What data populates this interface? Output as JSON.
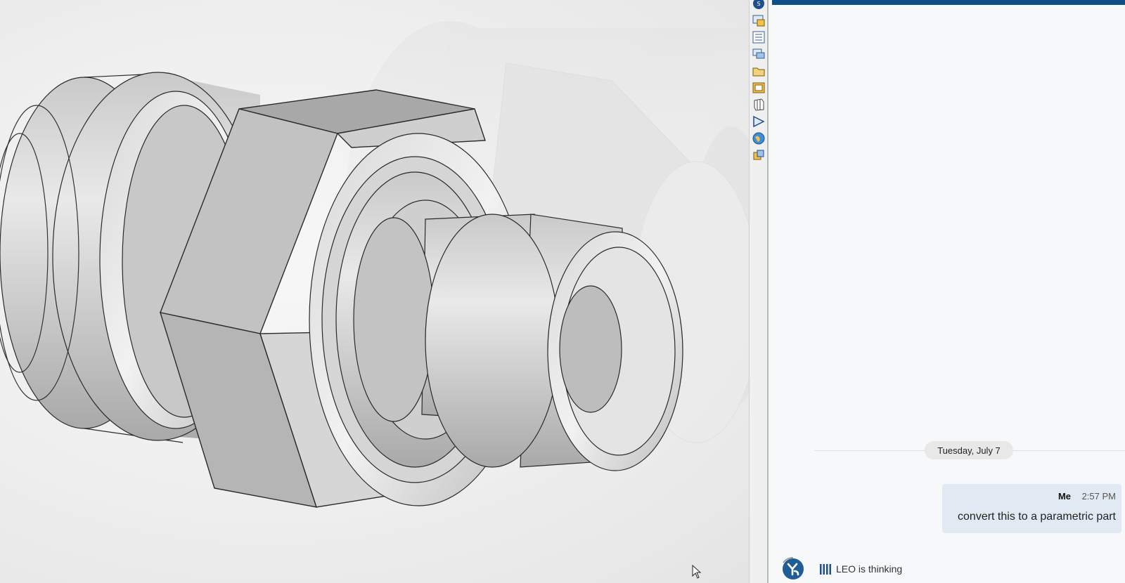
{
  "viewport": {
    "description_icon": "3d-cad-model"
  },
  "task_pane": {
    "buttons": [
      {
        "name": "solidworks-resources-icon"
      },
      {
        "name": "3d-content-central-icon"
      },
      {
        "name": "design-library-icon"
      },
      {
        "name": "forum-icon"
      },
      {
        "name": "file-explorer-icon"
      },
      {
        "name": "view-palette-icon"
      },
      {
        "name": "appearances-icon"
      },
      {
        "name": "custom-properties-icon"
      },
      {
        "name": "globe-icon"
      },
      {
        "name": "sustainability-icon"
      }
    ]
  },
  "chat": {
    "accent_color": "#0e4f86",
    "date_separator": "Tuesday, July 7",
    "messages": [
      {
        "sender": "Me",
        "time": "2:57 PM",
        "text": "convert this to a parametric part"
      }
    ],
    "assistant_status": "LEO is thinking"
  }
}
